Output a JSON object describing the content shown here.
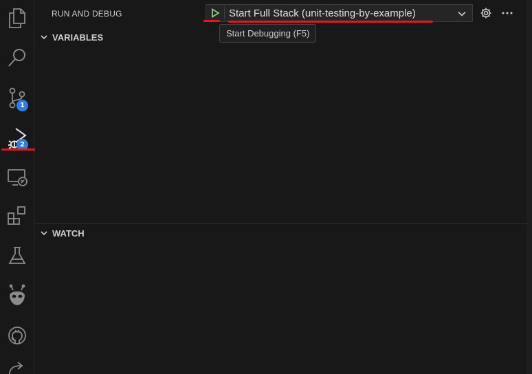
{
  "activity_bar": {
    "items": [
      {
        "name": "explorer",
        "icon": "files-icon"
      },
      {
        "name": "search",
        "icon": "search-icon"
      },
      {
        "name": "source-control",
        "icon": "source-control-icon",
        "badge": "1"
      },
      {
        "name": "run-and-debug",
        "icon": "run-debug-icon",
        "badge": "2"
      },
      {
        "name": "remote-explorer",
        "icon": "remote-explorer-icon"
      },
      {
        "name": "extensions",
        "icon": "extensions-icon"
      },
      {
        "name": "testing",
        "icon": "flask-icon"
      },
      {
        "name": "platformio",
        "icon": "alien-icon"
      },
      {
        "name": "github",
        "icon": "github-icon"
      },
      {
        "name": "share",
        "icon": "share-arrow-icon"
      }
    ]
  },
  "header": {
    "title": "RUN AND DEBUG",
    "config_label": "Start Full Stack (unit-testing-by-example)",
    "tooltip": "Start Debugging (F5)"
  },
  "sections": {
    "variables": "VARIABLES",
    "watch": "WATCH"
  },
  "colors": {
    "background": "#181818",
    "badge": "#2f7de1",
    "annotation_red": "#e8141e",
    "play_green": "#89d185"
  }
}
